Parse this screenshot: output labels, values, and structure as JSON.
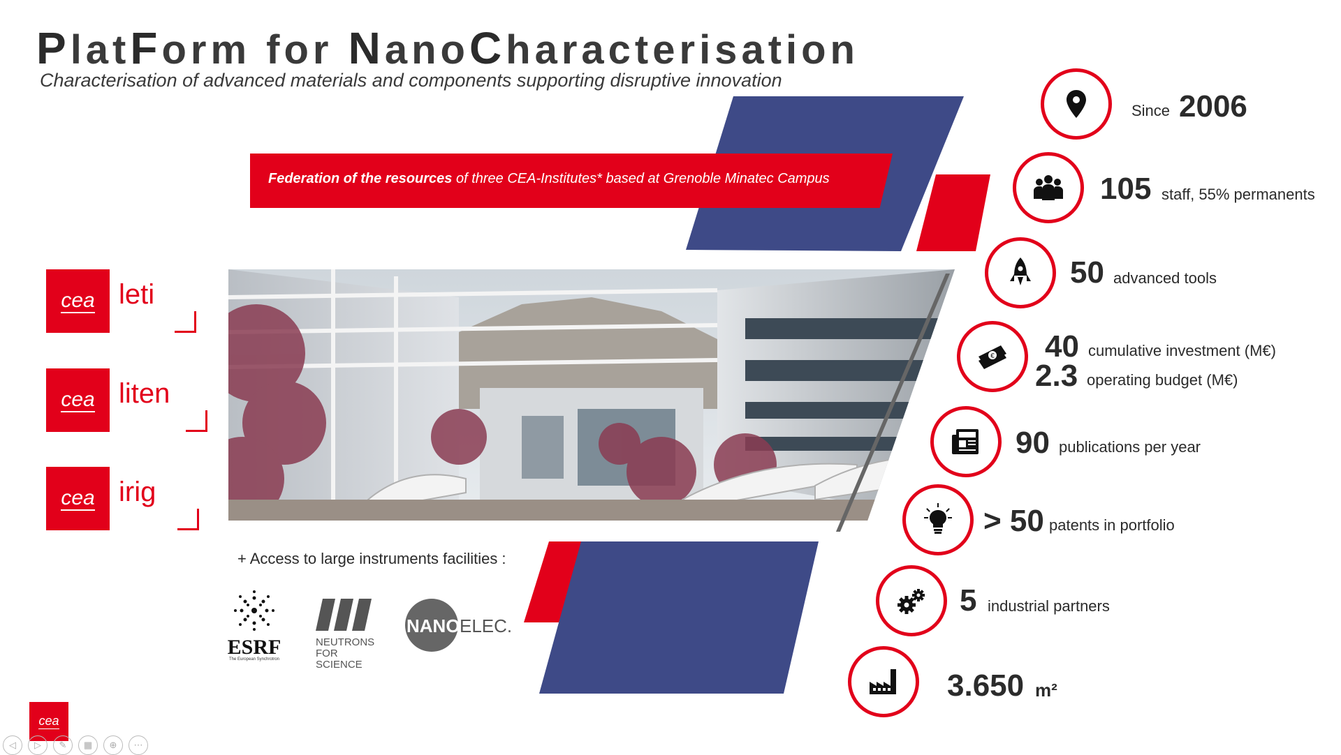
{
  "header": {
    "title_parts": [
      "P",
      "lat",
      "F",
      "orm for ",
      "N",
      "ano",
      "C",
      "haracterisation"
    ],
    "subtitle": "Characterisation of advanced materials and components supporting disruptive innovation"
  },
  "federation": {
    "bold": "Federation of the resources",
    "rest": " of three CEA-Institutes* based at Grenoble Minatec Campus"
  },
  "institutes": [
    {
      "logo": "cea",
      "name": "leti"
    },
    {
      "logo": "cea",
      "name": "liten"
    },
    {
      "logo": "cea",
      "name": "irig"
    }
  ],
  "access": {
    "label": "+ Access to large instruments facilities :",
    "partners": [
      {
        "name": "ESRF",
        "tagline": "The European Synchrotron"
      },
      {
        "name": "NEUTRONS",
        "tagline": "FOR SCIENCE"
      },
      {
        "name_a": "NANO",
        "name_b": "ELEC."
      }
    ]
  },
  "stats": [
    {
      "icon": "location-pin-icon",
      "pre": "Since",
      "num": "2006",
      "label": ""
    },
    {
      "icon": "people-group-icon",
      "num": "105",
      "label": "staff, 55% permanents"
    },
    {
      "icon": "rocket-icon",
      "num": "50",
      "label": "advanced tools"
    },
    {
      "icon": "money-euro-icon",
      "num": "40",
      "label": "cumulative investment (M€)",
      "num2": "2.3",
      "label2": "operating budget (M€)"
    },
    {
      "icon": "newspaper-icon",
      "num": "90",
      "label": "publications per year"
    },
    {
      "icon": "light-bulb-icon",
      "num": "> 50",
      "label": "patents in portfolio"
    },
    {
      "icon": "gears-icon",
      "num": "5",
      "label": "industrial partners"
    },
    {
      "icon": "factory-icon",
      "num": "3.650",
      "label": "m²"
    }
  ],
  "footer": {
    "logo": "cea"
  },
  "colors": {
    "red": "#e2001a",
    "navy": "#3e4a87",
    "text": "#2b2b2b"
  }
}
